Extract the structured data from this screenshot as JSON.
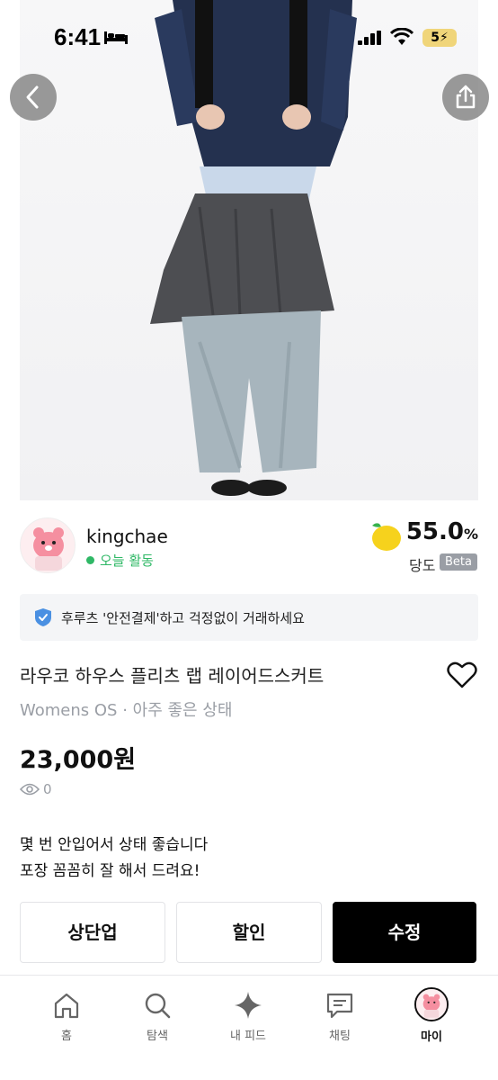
{
  "status_bar": {
    "time": "6:41",
    "battery": "5"
  },
  "seller": {
    "name": "kingchae",
    "activity": "오늘 활동",
    "temperature": "55.0",
    "temperature_unit": "%",
    "temperature_label": "당도",
    "beta_badge": "Beta"
  },
  "notice": {
    "text": "후루츠 '안전결제'하고 걱정없이 거래하세요"
  },
  "product": {
    "title": "라우코 하우스 플리츠 랩 레이어드스커트",
    "meta": "Womens OS · 아주 좋은 상태",
    "price": "23,000원",
    "views": "0",
    "description_lines": [
      "몇 번 안입어서 상태 좋습니다",
      "포장 꼼꼼히 잘 해서 드려요!"
    ]
  },
  "actions": {
    "bump": "상단업",
    "discount": "할인",
    "edit": "수정"
  },
  "tabbar": {
    "items": [
      {
        "label": "홈",
        "icon": "home-icon"
      },
      {
        "label": "탐색",
        "icon": "search-icon"
      },
      {
        "label": "내 피드",
        "icon": "sparkle-icon"
      },
      {
        "label": "채팅",
        "icon": "chat-icon"
      },
      {
        "label": "마이",
        "icon": "avatar"
      }
    ]
  },
  "colors": {
    "accent_green": "#2fb866",
    "primary_button": "#000000",
    "shield_blue": "#4a90e2"
  }
}
